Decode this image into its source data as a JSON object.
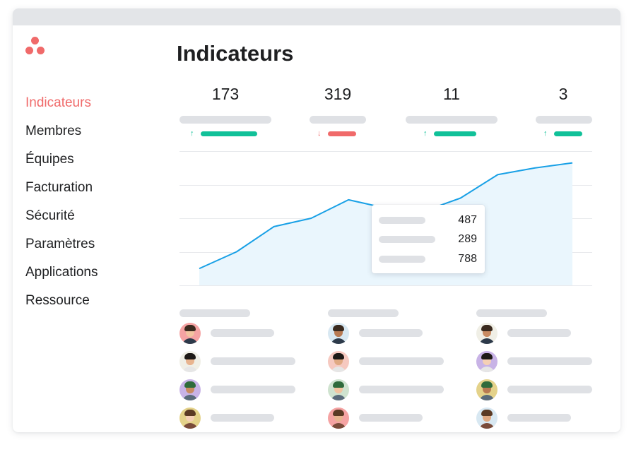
{
  "app": {
    "logo": "asana-dots-logo"
  },
  "sidebar": {
    "items": [
      {
        "label": "Indicateurs",
        "active": true
      },
      {
        "label": "Membres",
        "active": false
      },
      {
        "label": "Équipes",
        "active": false
      },
      {
        "label": "Facturation",
        "active": false
      },
      {
        "label": "Sécurité",
        "active": false
      },
      {
        "label": "Paramètres",
        "active": false
      },
      {
        "label": "Applications",
        "active": false
      },
      {
        "label": "Ressource",
        "active": false
      }
    ]
  },
  "main": {
    "title": "Indicateurs",
    "metrics": [
      {
        "value": "173",
        "trend": "up"
      },
      {
        "value": "319",
        "trend": "down"
      },
      {
        "value": "11",
        "trend": "up"
      },
      {
        "value": "3",
        "trend": "up"
      }
    ],
    "tooltip": {
      "values": [
        "487",
        "289",
        "788"
      ]
    },
    "columns": 3,
    "avatar_rows": 4
  },
  "colors": {
    "accent": "#f06a6a",
    "up": "#11c199",
    "down": "#f06a6a",
    "line": "#18a0e6",
    "area": "#eaf6fd",
    "placeholder": "#dfe1e5"
  },
  "chart_data": {
    "type": "area",
    "x": [
      1,
      2,
      3,
      4,
      5,
      6,
      7,
      8,
      9,
      10,
      11
    ],
    "values": [
      5,
      10,
      17.5,
      20,
      25.5,
      23,
      22,
      26,
      33,
      35,
      36.5
    ],
    "highlight_index": 5,
    "ylim": [
      0,
      40
    ],
    "grid": true
  }
}
